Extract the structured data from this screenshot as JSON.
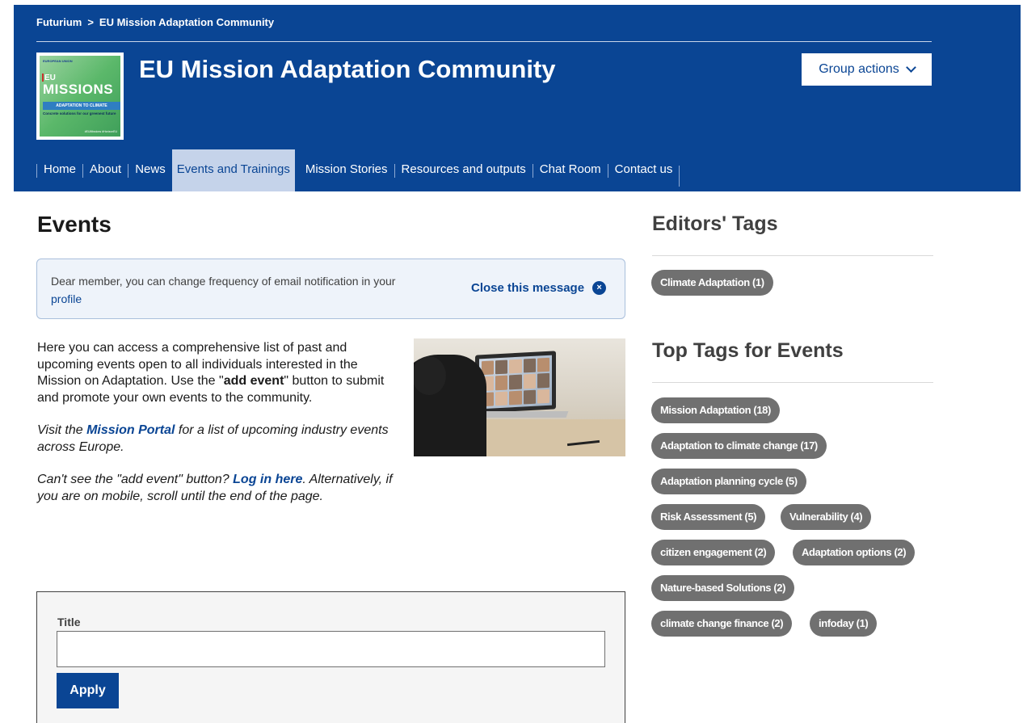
{
  "breadcrumb": {
    "items": [
      "Futurium",
      "EU Mission Adaptation Community"
    ],
    "separator": ">"
  },
  "logo": {
    "strip": "EUROPEAN UNION",
    "eu": "EU",
    "missions": "MISSIONS",
    "adaptation": "ADAPTATION TO CLIMATE",
    "tagline": "Concrete solutions for our greenest future",
    "bottom": "#EUMissions #HorizonEU"
  },
  "header": {
    "title": "EU Mission Adaptation Community",
    "group_actions_label": "Group actions"
  },
  "nav": {
    "items": [
      "Home",
      "About",
      "News",
      "Events and Trainings",
      "Mission Stories",
      "Resources and outputs",
      "Chat Room",
      "Contact us"
    ],
    "active": "Events and Trainings"
  },
  "main": {
    "title": "Events",
    "message": {
      "text": "Dear member, you can change frequency of email notification in your",
      "link": "profile",
      "close_label": "Close this message",
      "close_icon": "×"
    },
    "intro": {
      "p1_a": "Here you can access a comprehensive list of past and upcoming events open to all individuals interested in the Mission on Adaptation. Use the \"",
      "p1_bold": "add event",
      "p1_b": "\" button to submit and promote your own events to the community.",
      "p2_a": "Visit the ",
      "p2_link": "Mission Portal",
      "p2_b": " for a list of upcoming industry events across Europe.",
      "p3_a": "Can't see the \"add event\" button? ",
      "p3_link": "Log in here",
      "p3_b": ". Alternatively, if you are on mobile, scroll until the end of the page."
    },
    "filter": {
      "label": "Title",
      "value": "",
      "apply_label": "Apply"
    }
  },
  "sidebar": {
    "editors_title": "Editors' Tags",
    "editors_tags": [
      "Climate Adaptation (1)"
    ],
    "top_title": "Top Tags for Events",
    "top_tags": [
      "Mission Adaptation (18)",
      "Adaptation to climate change (17)",
      "Adaptation planning cycle (5)",
      "Risk Assessment (5)",
      "Vulnerability (4)",
      "citizen engagement (2)",
      "Adaptation options (2)",
      "Nature-based Solutions (2)",
      "climate change finance (2)",
      "infoday (1)"
    ]
  },
  "colors": {
    "brand": "#0a4594",
    "nav_active_bg": "#c5d3ea",
    "tag_bg": "#707070",
    "message_bg": "#eef3fa"
  }
}
